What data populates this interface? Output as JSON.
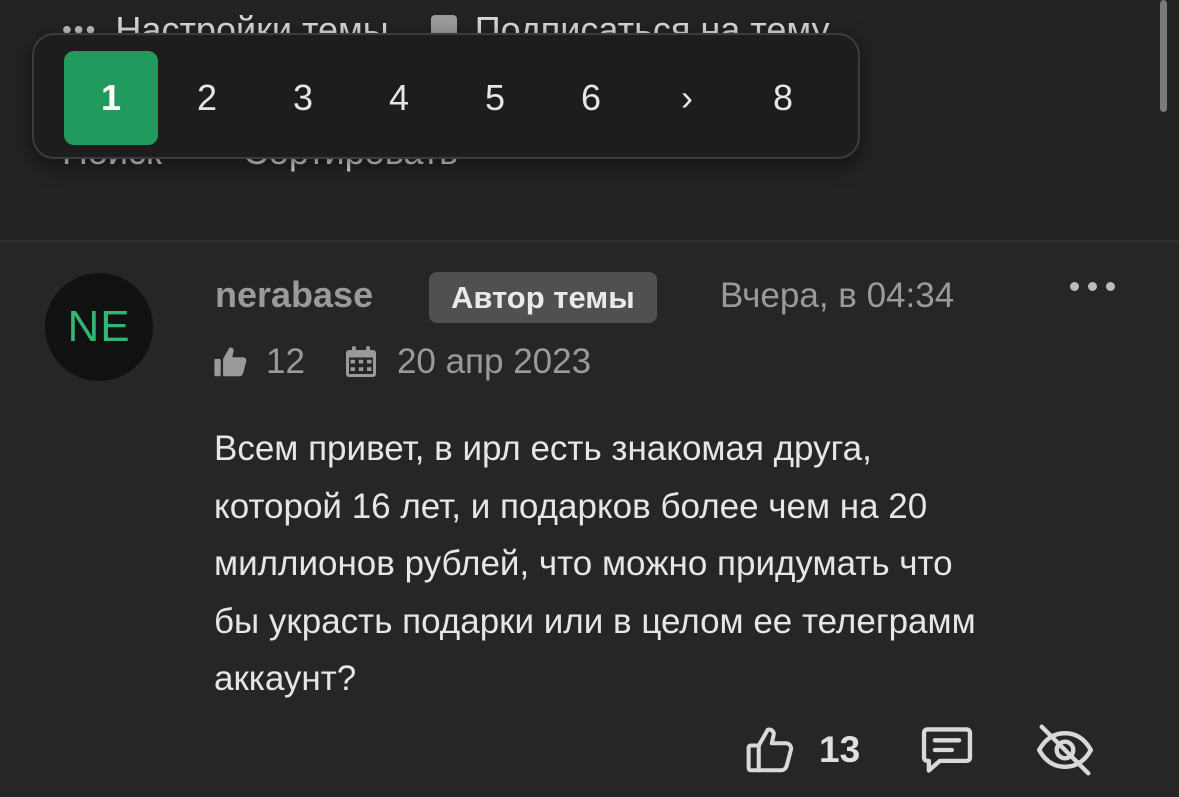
{
  "thread_bar": {
    "settings_label": "Настройки темы",
    "subscribe_label": "Подписаться на тему",
    "search_label": "Поиск",
    "sort_label": "Сортировать"
  },
  "pagination": {
    "pages": [
      "1",
      "2",
      "3",
      "4",
      "5",
      "6"
    ],
    "next_symbol": "›",
    "last_page": "8",
    "current_page": "1",
    "active_color": "#219a5e"
  },
  "post": {
    "avatar_initials": "NE",
    "avatar_color": "#33b575",
    "username": "nerabase",
    "author_badge": "Автор темы",
    "timestamp": "Вчера, в 04:34",
    "author_likes": "12",
    "registration_date": "20 апр 2023",
    "body_lines": [
      "Всем привет, в ирл есть знакомая друга,",
      "которой 16 лет, и подарков более чем на 20",
      "миллионов рублей, что можно придумать что",
      "бы украсть подарки или в целом ее телеграмм",
      "аккаунт?"
    ],
    "like_count": "13",
    "icons": {
      "author_likes": "thumbs-up-filled-icon",
      "registration": "calendar-icon",
      "like": "thumbs-up-outline-icon",
      "reply": "message-square-icon",
      "hide": "eye-off-icon",
      "more": "more-horizontal-icon"
    }
  }
}
